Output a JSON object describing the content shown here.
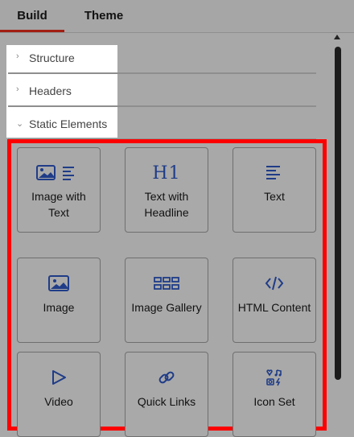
{
  "tabs": [
    {
      "label": "Build",
      "active": true
    },
    {
      "label": "Theme",
      "active": false
    }
  ],
  "sections": [
    {
      "label": "Structure",
      "expanded": false
    },
    {
      "label": "Headers",
      "expanded": false
    },
    {
      "label": "Static Elements",
      "expanded": true
    }
  ],
  "elements": [
    {
      "label": "Image with Text",
      "icon": "image-with-text-icon"
    },
    {
      "label": "Text with Headline",
      "icon": "h1-headline-icon",
      "icon_text": "H1"
    },
    {
      "label": "Text",
      "icon": "text-lines-icon"
    },
    {
      "label": "Image",
      "icon": "image-icon"
    },
    {
      "label": "Image Gallery",
      "icon": "gallery-grid-icon"
    },
    {
      "label": "HTML Content",
      "icon": "code-icon"
    },
    {
      "label": "Video",
      "icon": "play-icon"
    },
    {
      "label": "Quick Links",
      "icon": "link-icon"
    },
    {
      "label": "Icon Set",
      "icon": "icon-set-icon"
    }
  ],
  "colors": {
    "accent": "#a11d12",
    "icon": "#1f3c88",
    "highlight_border": "#ff0000",
    "overlay_bg": "#a8a8a8"
  }
}
